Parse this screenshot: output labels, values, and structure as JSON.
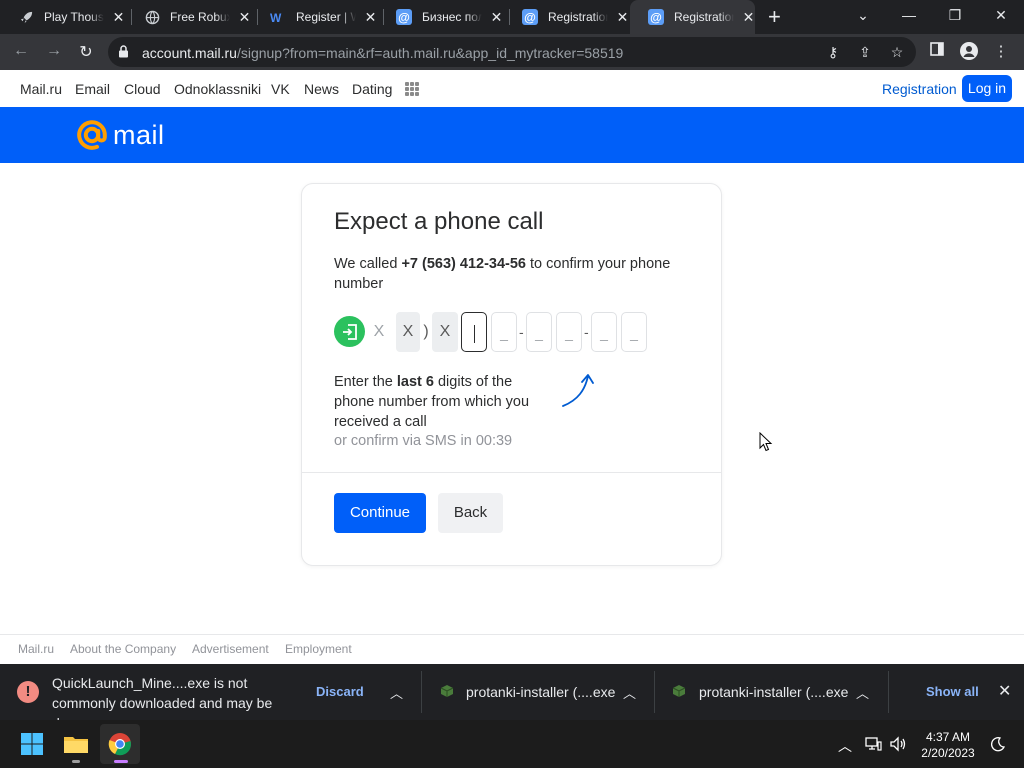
{
  "browser": {
    "tabs": [
      {
        "title": "Play Thousands",
        "icon": "rocket-icon",
        "active": false
      },
      {
        "title": "Free Robux",
        "icon": "globe-icon",
        "active": false
      },
      {
        "title": "Register | W",
        "icon": "w-logo-icon",
        "active": false
      },
      {
        "title": "Бизнес пол",
        "icon": "mail-at-icon",
        "active": false
      },
      {
        "title": "Registration",
        "icon": "mail-at-icon",
        "active": false
      },
      {
        "title": "Registration",
        "icon": "mail-at-icon",
        "active": true
      }
    ],
    "url_host": "account.mail.ru",
    "url_path": "/signup?from=main&rf=auth.mail.ru&app_id_mytracker=58519"
  },
  "portal_nav": {
    "items": [
      "Mail.ru",
      "Email",
      "Cloud",
      "Odnoklassniki",
      "VK",
      "News",
      "Dating"
    ],
    "registration": "Registration",
    "login": "Log in"
  },
  "logo": {
    "text": "mail"
  },
  "card": {
    "title": "Expect a phone call",
    "desc_prefix": "We called ",
    "phone": "+7 (563) 412-34-56",
    "desc_suffix": " to confirm your phone number",
    "prefix_chars": [
      "X",
      "X",
      ")",
      "X"
    ],
    "digit_placeholders": [
      "",
      "_",
      "_",
      "_",
      "_",
      "_"
    ],
    "digit_separator": "-",
    "hint_prefix": "Enter the ",
    "hint_bold": "last 6",
    "hint_suffix": " digits of the phone number from which you received a call",
    "sms_text": "or confirm via SMS in 00:39",
    "continue": "Continue",
    "back": "Back"
  },
  "footer": [
    "Mail.ru",
    "About the Company",
    "Advertisement",
    "Employment"
  ],
  "downloads": {
    "warning": "QuickLaunch_Mine....exe is not commonly downloaded and may be dangerous.",
    "discard": "Discard",
    "files": [
      "protanki-installer (....exe",
      "protanki-installer (....exe"
    ],
    "show_all": "Show all"
  },
  "taskbar": {
    "time": "4:37 AM",
    "date": "2/20/2023"
  },
  "colors": {
    "accent": "#005ff9",
    "success": "#2bc15e",
    "logo_orange": "#ff9e00"
  }
}
